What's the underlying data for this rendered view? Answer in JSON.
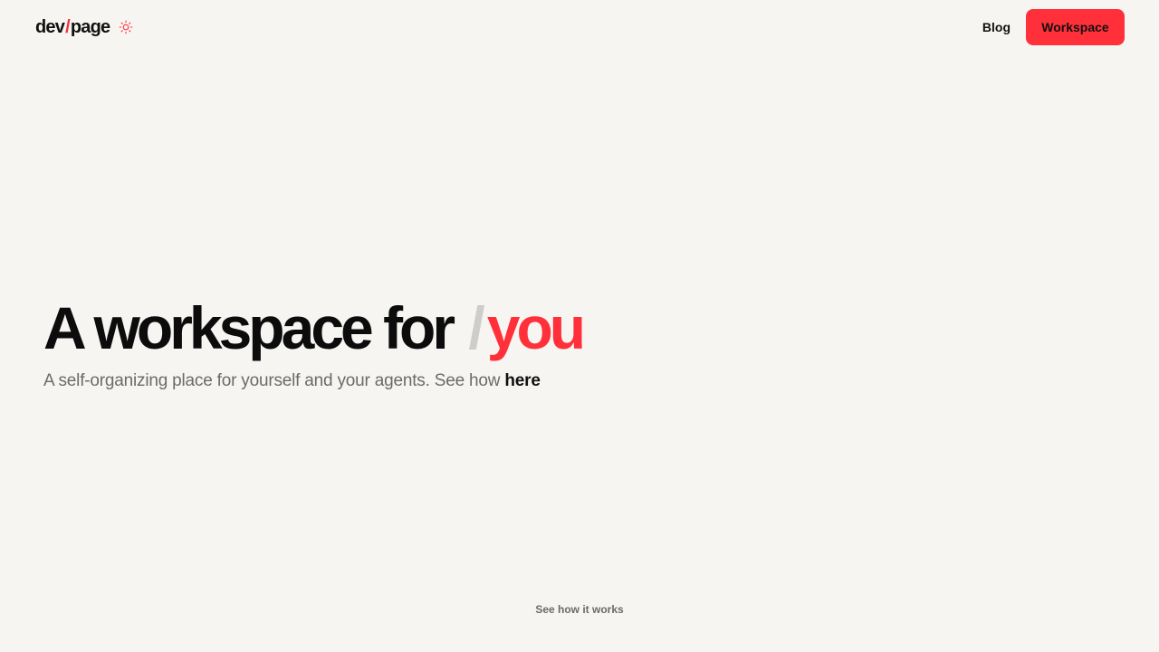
{
  "header": {
    "logo": {
      "part1": "dev",
      "slash": "/",
      "part2": "page"
    },
    "theme_toggle_icon": "sun-icon",
    "nav": {
      "blog_label": "Blog",
      "workspace_label": "Workspace"
    }
  },
  "hero": {
    "title_main": "A workspace for",
    "title_slash": "/",
    "title_accent": "you",
    "subtitle_text": "A self-organizing place for yourself and your agents. See how",
    "subtitle_link": "here"
  },
  "footer": {
    "see_how_label": "See how it works"
  },
  "colors": {
    "background": "#f6f5f2",
    "accent": "#ff3039",
    "slash_muted": "#cfcdca",
    "text": "#111111",
    "muted_text": "#6b6b6b"
  }
}
